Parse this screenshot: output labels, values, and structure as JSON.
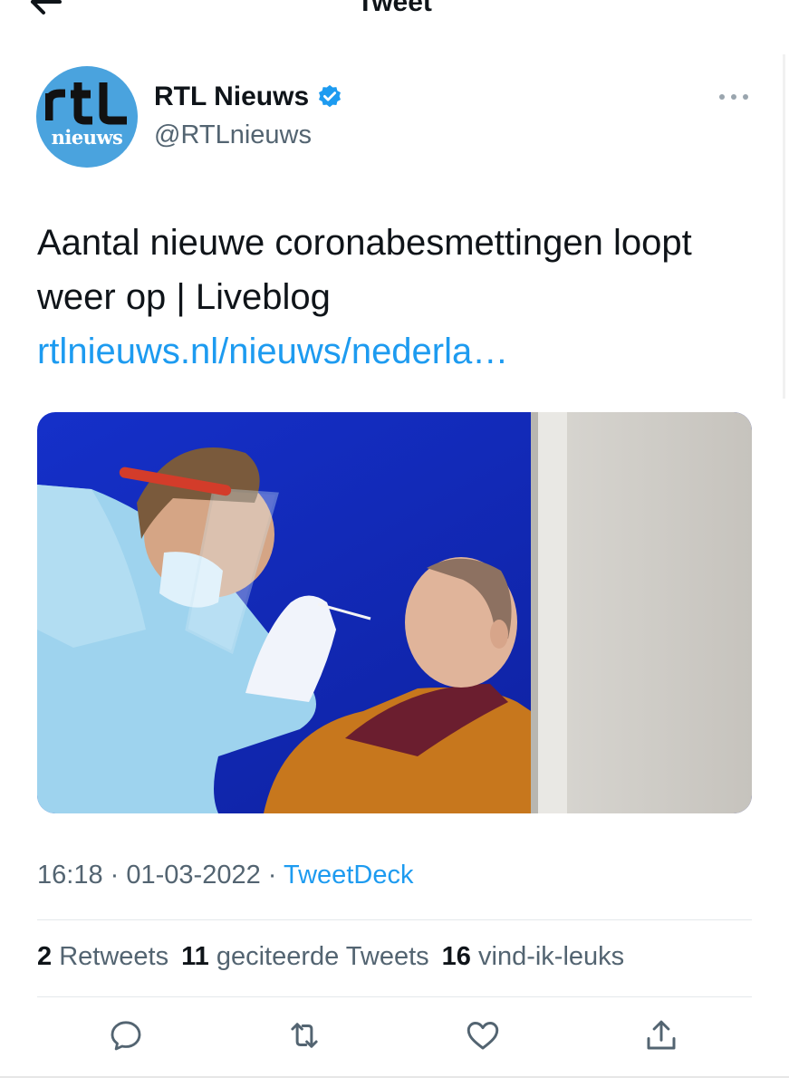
{
  "header": {
    "title": "Tweet",
    "back_icon": "arrow-left-icon"
  },
  "author": {
    "avatar_text_top": "rtl",
    "avatar_text_bottom": "nieuws",
    "avatar_color": "#4aa3de",
    "display_name": "RTL Nieuws",
    "handle": "@RTLnieuws",
    "verified": true,
    "verified_icon": "verified-badge-icon",
    "more_icon": "more-dots-icon"
  },
  "tweet": {
    "text": "Aantal nieuwe coronabesmettingen loopt weer op | Liveblog ",
    "link": "rtlnieuws.nl/nieuws/nederla…",
    "link_color": "#1d9bf0"
  },
  "meta": {
    "time": "16:18",
    "separator": "·",
    "date": "01-03-2022",
    "source": "TweetDeck"
  },
  "stats": {
    "retweets_count": "2",
    "retweets_label": "Retweets",
    "quotes_count": "11",
    "quotes_label": "geciteerde Tweets",
    "likes_count": "16",
    "likes_label": "vind-ik-leuks"
  },
  "actions": {
    "reply_icon": "reply-bubble-icon",
    "retweet_icon": "retweet-icon",
    "like_icon": "heart-icon",
    "share_icon": "share-icon",
    "icon_color": "#536471"
  }
}
